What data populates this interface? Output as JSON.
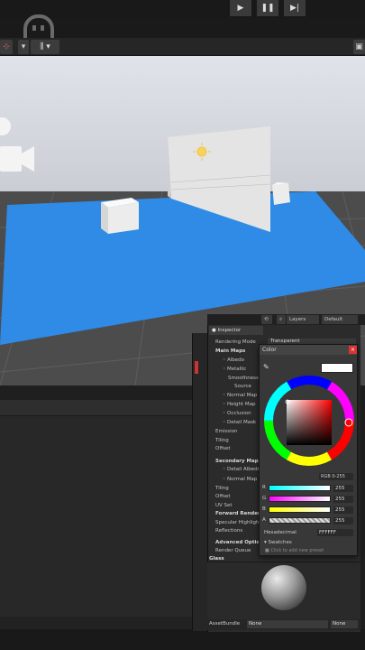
{
  "toolbar": {
    "play_icon": "play-icon",
    "pause_icon": "pause-icon",
    "step_icon": "step-icon"
  },
  "inspector": {
    "top_layers": "Layers",
    "top_layout": "Default",
    "tab_label": "Inspector",
    "rendering_mode_label": "Rendering Mode",
    "rendering_mode_value": "Transparent",
    "main_maps": "Main Maps",
    "albedo": "Albedo",
    "metallic": "Metallic",
    "smoothness": "Smoothness",
    "source": "Source",
    "normal_map": "Normal Map",
    "height_map": "Height Map",
    "occlusion": "Occlusion",
    "detail_mask": "Detail Mask",
    "emission": "Emission",
    "tiling": "Tiling",
    "offset": "Offset",
    "secondary_maps": "Secondary Maps",
    "detail_albedo": "Detail Albedo",
    "normal_map2": "Normal Map",
    "tiling2": "Tiling",
    "offset2": "Offset",
    "uv_set": "UV Set",
    "forward_rendering": "Forward Rendering",
    "specular_highlights": "Specular Highlights",
    "reflections": "Reflections",
    "advanced_options": "Advanced Options",
    "render_queue": "Render Queue",
    "material_name": "Glass",
    "asset_bundle_label": "AssetBundle",
    "asset_bundle_value": "None",
    "asset_bundle_variant": "None"
  },
  "color_picker": {
    "title": "Color",
    "mode": "RGB 0-255",
    "channels": [
      {
        "label": "R",
        "value": "255"
      },
      {
        "label": "G",
        "value": "255"
      },
      {
        "label": "B",
        "value": "255"
      },
      {
        "label": "A",
        "value": "255"
      }
    ],
    "hex_label": "Hexadecimal",
    "hex_value": "FFFFFF",
    "swatches_label": "Swatches",
    "add_preset": "Click to add new preset",
    "colors": {
      "current": "#FFFFFF",
      "selected_hue": "#ff0000"
    }
  },
  "colors": {
    "plane": "#2f8be6",
    "scene_bg": "#4d4d4d",
    "panel": "#2b2b2b",
    "accent": "#3a72c4"
  }
}
